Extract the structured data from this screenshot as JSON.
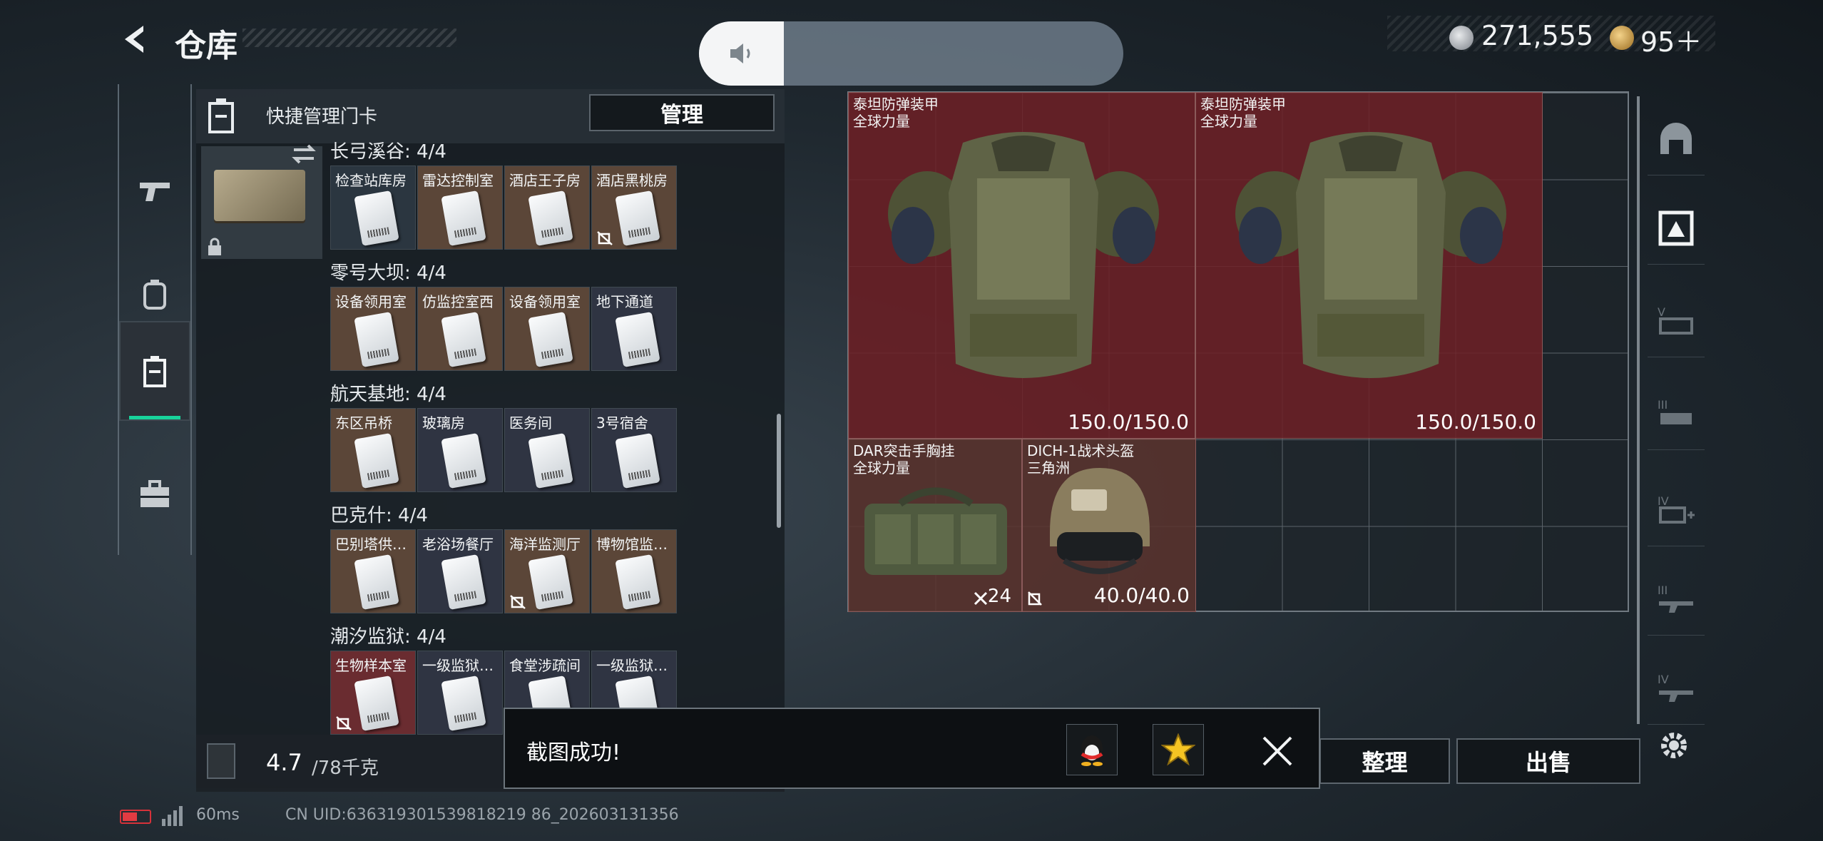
{
  "header": {
    "title": "仓库"
  },
  "volume": {
    "level": 0.2
  },
  "currency": {
    "silver": "271,555",
    "gold": "95＋"
  },
  "left_panel": {
    "title": "快捷管理门卡",
    "manage_label": "管理",
    "regions": [
      {
        "name": "长弓溪谷: 4/4",
        "slots": [
          {
            "label": "检查站库房",
            "tint": "#2b3640",
            "unbound": false
          },
          {
            "label": "雷达控制室",
            "tint": "#5b4638",
            "unbound": false
          },
          {
            "label": "酒店王子房",
            "tint": "#5b4638",
            "unbound": false
          },
          {
            "label": "酒店黑桃房",
            "tint": "#5b4638",
            "unbound": true
          }
        ]
      },
      {
        "name": "零号大坝: 4/4",
        "slots": [
          {
            "label": "设备领用室",
            "tint": "#5b4638",
            "unbound": false
          },
          {
            "label": "仿监控室西",
            "tint": "#5b4638",
            "unbound": false
          },
          {
            "label": "设备领用室",
            "tint": "#5b4638",
            "unbound": false
          },
          {
            "label": "地下通道",
            "tint": "#2f3442",
            "unbound": false
          }
        ]
      },
      {
        "name": "航天基地: 4/4",
        "slots": [
          {
            "label": "东区吊桥",
            "tint": "#5b4638",
            "unbound": false
          },
          {
            "label": "玻璃房",
            "tint": "#2f3442",
            "unbound": false
          },
          {
            "label": "医务间",
            "tint": "#2f3442",
            "unbound": false
          },
          {
            "label": "3号宿舍",
            "tint": "#2f3442",
            "unbound": false
          }
        ]
      },
      {
        "name": "巴克什: 4/4",
        "slots": [
          {
            "label": "巴别塔供…",
            "tint": "#5b4638",
            "unbound": false
          },
          {
            "label": "老浴场餐厅",
            "tint": "#2f3442",
            "unbound": false
          },
          {
            "label": "海洋监测厅",
            "tint": "#5b4638",
            "unbound": true
          },
          {
            "label": "博物馆监…",
            "tint": "#5b4638",
            "unbound": false
          }
        ]
      },
      {
        "name": "潮汐监狱: 4/4",
        "slots": [
          {
            "label": "生物样本室",
            "tint": "#6a2c30",
            "unbound": true
          },
          {
            "label": "一级监狱…",
            "tint": "#2f3442",
            "unbound": false
          },
          {
            "label": "食堂涉疏间",
            "tint": "#2f3442",
            "unbound": false
          },
          {
            "label": "一级监狱…",
            "tint": "#2f3442",
            "unbound": false
          }
        ]
      }
    ],
    "weight_value": "4.7",
    "weight_max": "/78千克"
  },
  "grid_items": [
    {
      "name": "泰坦防弹装甲",
      "sub": "全球力量",
      "value": "150.0/150.0",
      "kind": "armor"
    },
    {
      "name": "泰坦防弹装甲",
      "sub": "全球力量",
      "value": "150.0/150.0",
      "kind": "armor"
    },
    {
      "name": "DAR突击手胸挂",
      "sub": "全球力量",
      "qty": "24",
      "kind": "rig"
    },
    {
      "name": "DICH-1战术头盔",
      "sub": "三角洲",
      "value": "40.0/40.0",
      "kind": "helmet"
    }
  ],
  "bottom_buttons": {
    "sort": "整理",
    "sell": "出售"
  },
  "toast": {
    "text": "截图成功!"
  },
  "footer": {
    "ping": "60ms",
    "uid": "CN UID:636319301539818219 86_202603131356"
  },
  "colors": {
    "accent": "#18d39b",
    "item_red": "#6e2026",
    "item_brown": "#5c342e",
    "battery": "#e23b42"
  }
}
